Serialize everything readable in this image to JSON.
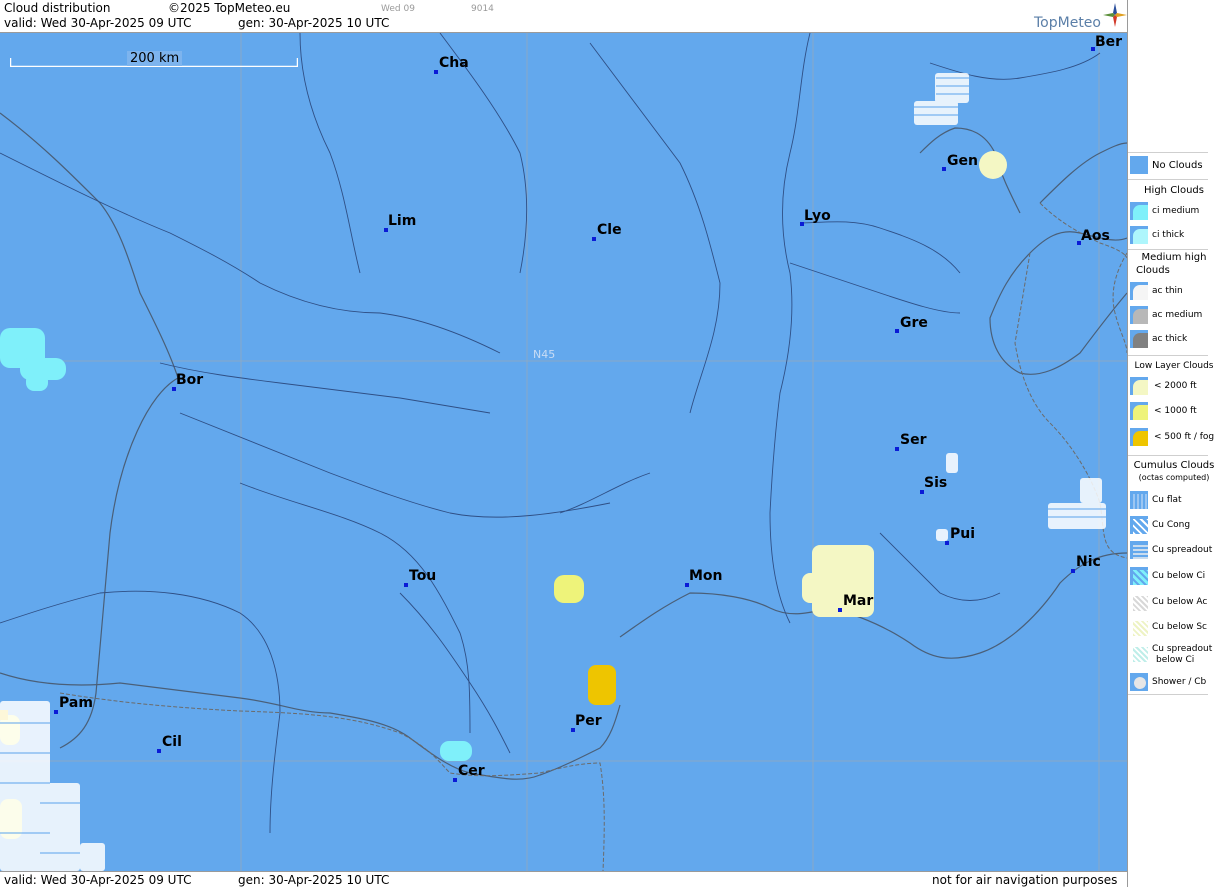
{
  "header": {
    "title": "Cloud distribution",
    "copyright": "©2025 TopMeteo.eu",
    "day_small": "Wed 09",
    "code_small": "9014",
    "valid": "valid:  Wed  30-Apr-2025  09 UTC",
    "gen": "gen: 30-Apr-2025 10 UTC",
    "brand": "TopMeteo"
  },
  "map": {
    "scale_label": "200 km",
    "lat_label": "N45",
    "cities": [
      {
        "name": "Cha"
      },
      {
        "name": "Ber"
      },
      {
        "name": "Gen"
      },
      {
        "name": "Lim"
      },
      {
        "name": "Cle"
      },
      {
        "name": "Lyo"
      },
      {
        "name": "Aos"
      },
      {
        "name": "Gre"
      },
      {
        "name": "Bor"
      },
      {
        "name": "Ser"
      },
      {
        "name": "Sis"
      },
      {
        "name": "Pui"
      },
      {
        "name": "Tou"
      },
      {
        "name": "Mon"
      },
      {
        "name": "Mar"
      },
      {
        "name": "Nic"
      },
      {
        "name": "Pam"
      },
      {
        "name": "Per"
      },
      {
        "name": "Cil"
      },
      {
        "name": "Cer"
      }
    ]
  },
  "footer": {
    "valid": "valid:  Wed  30-Apr-2025  09 UTC",
    "gen": "gen: 30-Apr-2025 10 UTC",
    "disclaimer": "not for air navigation purposes"
  },
  "legend": {
    "no_clouds": "No Clouds",
    "high_head": "High Clouds",
    "ci_medium": "ci medium",
    "ci_thick": "ci thick",
    "medium_head_1": "Medium high",
    "medium_head_2": "Clouds",
    "ac_thin": "ac thin",
    "ac_medium": "ac medium",
    "ac_thick": "ac thick",
    "low_head": "Low Layer Clouds",
    "low_2000": "< 2000 ft",
    "low_1000": "< 1000 ft",
    "low_500": "< 500 ft / fog",
    "cu_head_1": "Cumulus Clouds",
    "cu_head_2": "(octas computed)",
    "cu_flat": "Cu flat",
    "cu_cong": "Cu Cong",
    "cu_spread": "Cu spreadout",
    "cu_below_ci": "Cu below Ci",
    "cu_below_ac": "Cu below Ac",
    "cu_below_sc": "Cu below Sc",
    "cu_spread_ci_1": "Cu spreadout",
    "cu_spread_ci_2": "below Ci",
    "shower": "Shower / Cb"
  },
  "colors": {
    "no_clouds": "#63a8ed",
    "ci": "#7ff0fa",
    "low_2000": "#f4f7c4",
    "low_1000": "#eef37a",
    "low_500": "#eec500",
    "ac_thin": "#f5f5f5",
    "ac_medium": "#b8b8b8",
    "ac_thick": "#808080"
  }
}
